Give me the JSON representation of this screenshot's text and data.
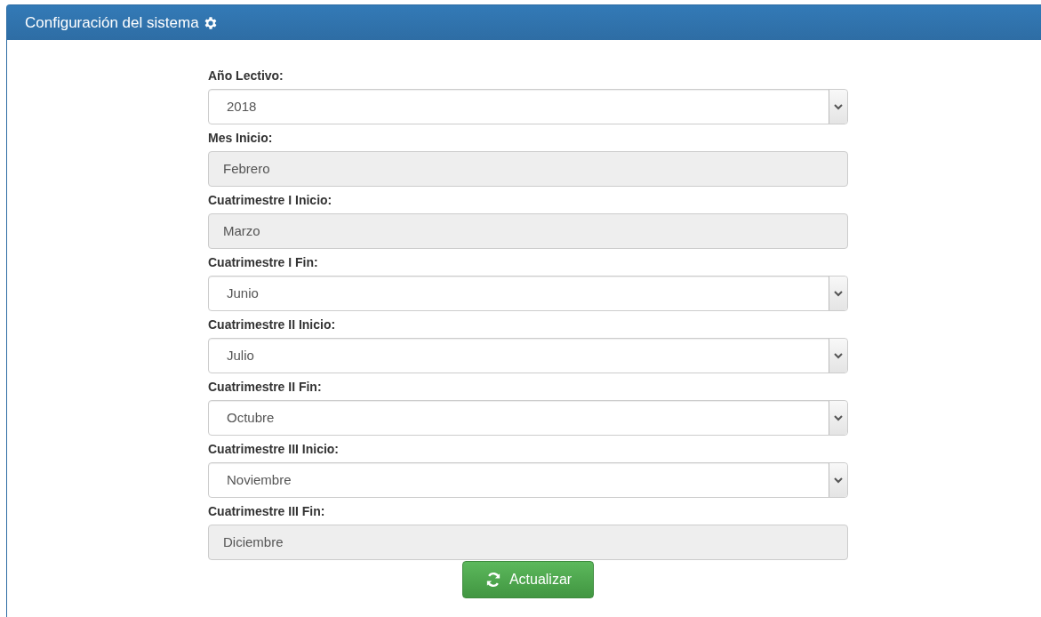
{
  "panel": {
    "title": "Configuración del sistema"
  },
  "fields": [
    {
      "label": "Año Lectivo:",
      "kind": "select",
      "value": "2018"
    },
    {
      "label": "Mes Inicio:",
      "kind": "readonly",
      "value": "Febrero"
    },
    {
      "label": "Cuatrimestre I Inicio:",
      "kind": "readonly",
      "value": "Marzo"
    },
    {
      "label": "Cuatrimestre I Fin:",
      "kind": "select",
      "value": "Junio"
    },
    {
      "label": "Cuatrimestre II Inicio:",
      "kind": "select",
      "value": "Julio"
    },
    {
      "label": "Cuatrimestre II Fin:",
      "kind": "select",
      "value": "Octubre"
    },
    {
      "label": "Cuatrimestre III Inicio:",
      "kind": "select",
      "value": "Noviembre"
    },
    {
      "label": "Cuatrimestre III Fin:",
      "kind": "readonly",
      "value": "Diciembre"
    }
  ],
  "button": {
    "label": "Actualizar"
  }
}
